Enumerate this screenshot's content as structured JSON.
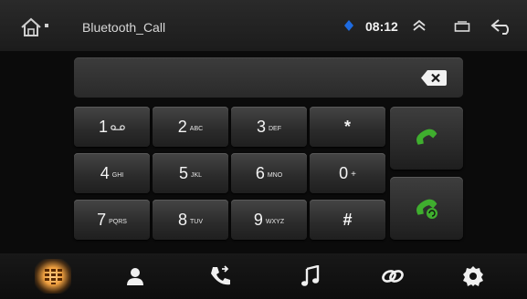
{
  "status_bar": {
    "title": "Bluetooth_Call",
    "time": "08:12",
    "icons": [
      "home-icon",
      "bluetooth-icon",
      "chevron-up-icon",
      "recent-apps-icon",
      "back-icon"
    ]
  },
  "dialer": {
    "number": "",
    "keys": [
      {
        "digit": "1",
        "letters": "ᴑ_ᴑ"
      },
      {
        "digit": "2",
        "letters": "ABC"
      },
      {
        "digit": "3",
        "letters": "DEF"
      },
      {
        "digit": "*",
        "letters": ""
      },
      {
        "digit": "4",
        "letters": "GHI"
      },
      {
        "digit": "5",
        "letters": "JKL"
      },
      {
        "digit": "6",
        "letters": "MNO"
      },
      {
        "digit": "0",
        "letters": "+"
      },
      {
        "digit": "7",
        "letters": "PQRS"
      },
      {
        "digit": "8",
        "letters": "TUV"
      },
      {
        "digit": "9",
        "letters": "WXYZ"
      },
      {
        "digit": "#",
        "letters": ""
      }
    ],
    "call_button_icon": "phone-call-icon",
    "redial_button_icon": "phone-redial-icon",
    "delete_icon": "backspace-icon"
  },
  "bottom_nav": {
    "tabs": [
      {
        "icon": "dialpad-icon",
        "active": true
      },
      {
        "icon": "contacts-icon",
        "active": false
      },
      {
        "icon": "call-log-icon",
        "active": false
      },
      {
        "icon": "music-icon",
        "active": false
      },
      {
        "icon": "link-icon",
        "active": false
      },
      {
        "icon": "settings-icon",
        "active": false
      }
    ]
  },
  "colors": {
    "accent_active": "#f0a040",
    "call_green": "#3fae2e",
    "bluetooth_blue": "#1e6be0"
  }
}
